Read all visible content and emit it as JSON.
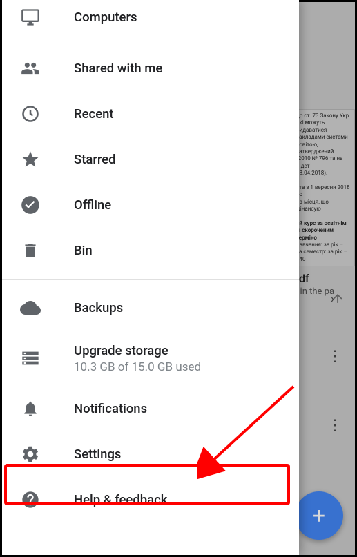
{
  "drawer": {
    "items": [
      {
        "label": "Computers",
        "icon": "monitor"
      },
      {
        "label": "Shared with me",
        "icon": "people"
      },
      {
        "label": "Recent",
        "icon": "clock"
      },
      {
        "label": "Starred",
        "icon": "star"
      },
      {
        "label": "Offline",
        "icon": "offline"
      },
      {
        "label": "Bin",
        "icon": "trash"
      }
    ],
    "bottom_items": [
      {
        "label": "Backups",
        "icon": "cloud"
      },
      {
        "label": "Upgrade storage",
        "sublabel": "10.3 GB of 15.0 GB used",
        "icon": "storage"
      },
      {
        "label": "Notifications",
        "icon": "bell"
      },
      {
        "label": "Settings",
        "icon": "gear"
      },
      {
        "label": "Help & feedback",
        "icon": "help"
      }
    ]
  },
  "backdrop": {
    "file_ext": "pdf",
    "file_sub": "d in the pa",
    "sort_partial": "›",
    "fab": "+"
  }
}
